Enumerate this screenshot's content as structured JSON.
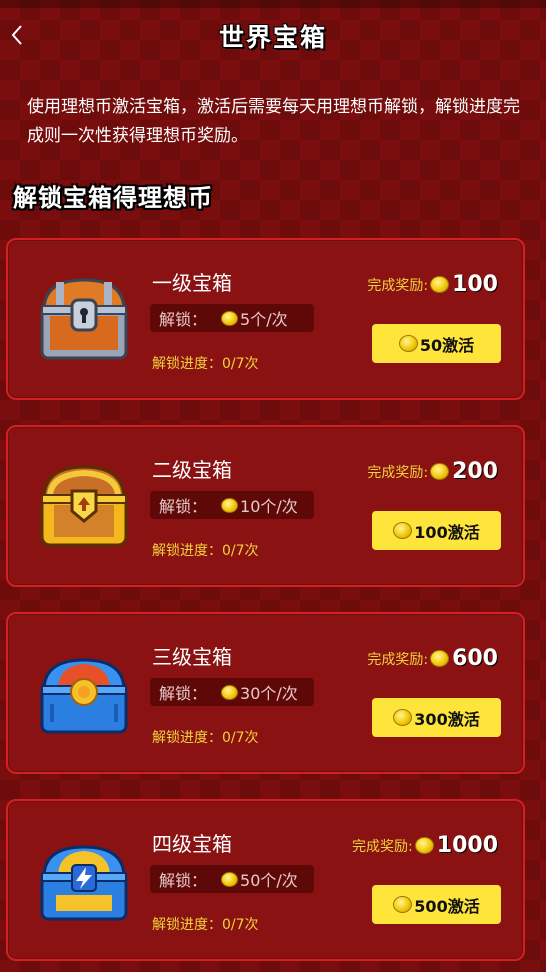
{
  "header": {
    "title": "世界宝箱"
  },
  "description": "使用理想币激活宝箱，激活后需要每天用理想币解锁，解锁进度完成则一次性获得理想币奖励。",
  "section_title": "解锁宝箱得理想币",
  "cards": [
    {
      "name": "一级宝箱",
      "unlock_label": "解锁：",
      "unlock_cost": "5个/次",
      "progress": "解锁进度：0/7次",
      "reward_label": "完成奖励:",
      "reward_value": "100",
      "button_label": "50激活",
      "chest_color": "steel"
    },
    {
      "name": "二级宝箱",
      "unlock_label": "解锁：",
      "unlock_cost": "10个/次",
      "progress": "解锁进度：0/7次",
      "reward_label": "完成奖励:",
      "reward_value": "200",
      "button_label": "100激活",
      "chest_color": "gold"
    },
    {
      "name": "三级宝箱",
      "unlock_label": "解锁：",
      "unlock_cost": "30个/次",
      "progress": "解锁进度：0/7次",
      "reward_label": "完成奖励:",
      "reward_value": "600",
      "button_label": "300激活",
      "chest_color": "blue-orange"
    },
    {
      "name": "四级宝箱",
      "unlock_label": "解锁：",
      "unlock_cost": "50个/次",
      "progress": "解锁进度：0/7次",
      "reward_label": "完成奖励:",
      "reward_value": "1000",
      "button_label": "500激活",
      "chest_color": "blue-gold"
    }
  ],
  "colors": {
    "background": "#7a0d0d",
    "card": "#8a1212",
    "card_border": "#d42020",
    "accent_yellow": "#ffe43c",
    "label_yellow": "#f2d23a"
  }
}
